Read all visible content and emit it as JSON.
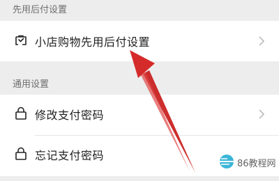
{
  "sections": [
    {
      "header": "先用后付设置",
      "items": [
        {
          "label": "小店购物先用后付设置",
          "icon": "shopping-bag-check-icon",
          "has_chevron": true
        }
      ]
    },
    {
      "header": "通用设置",
      "items": [
        {
          "label": "修改支付密码",
          "icon": "lock-icon",
          "has_chevron": true
        },
        {
          "label": "忘记支付密码",
          "icon": "lock-icon",
          "has_chevron": false
        }
      ]
    }
  ],
  "watermark": {
    "text": "86教程网"
  },
  "colors": {
    "background": "#ededed",
    "card": "#ffffff",
    "arrow": "#d42a2a",
    "chevron": "#b5b5b5"
  }
}
